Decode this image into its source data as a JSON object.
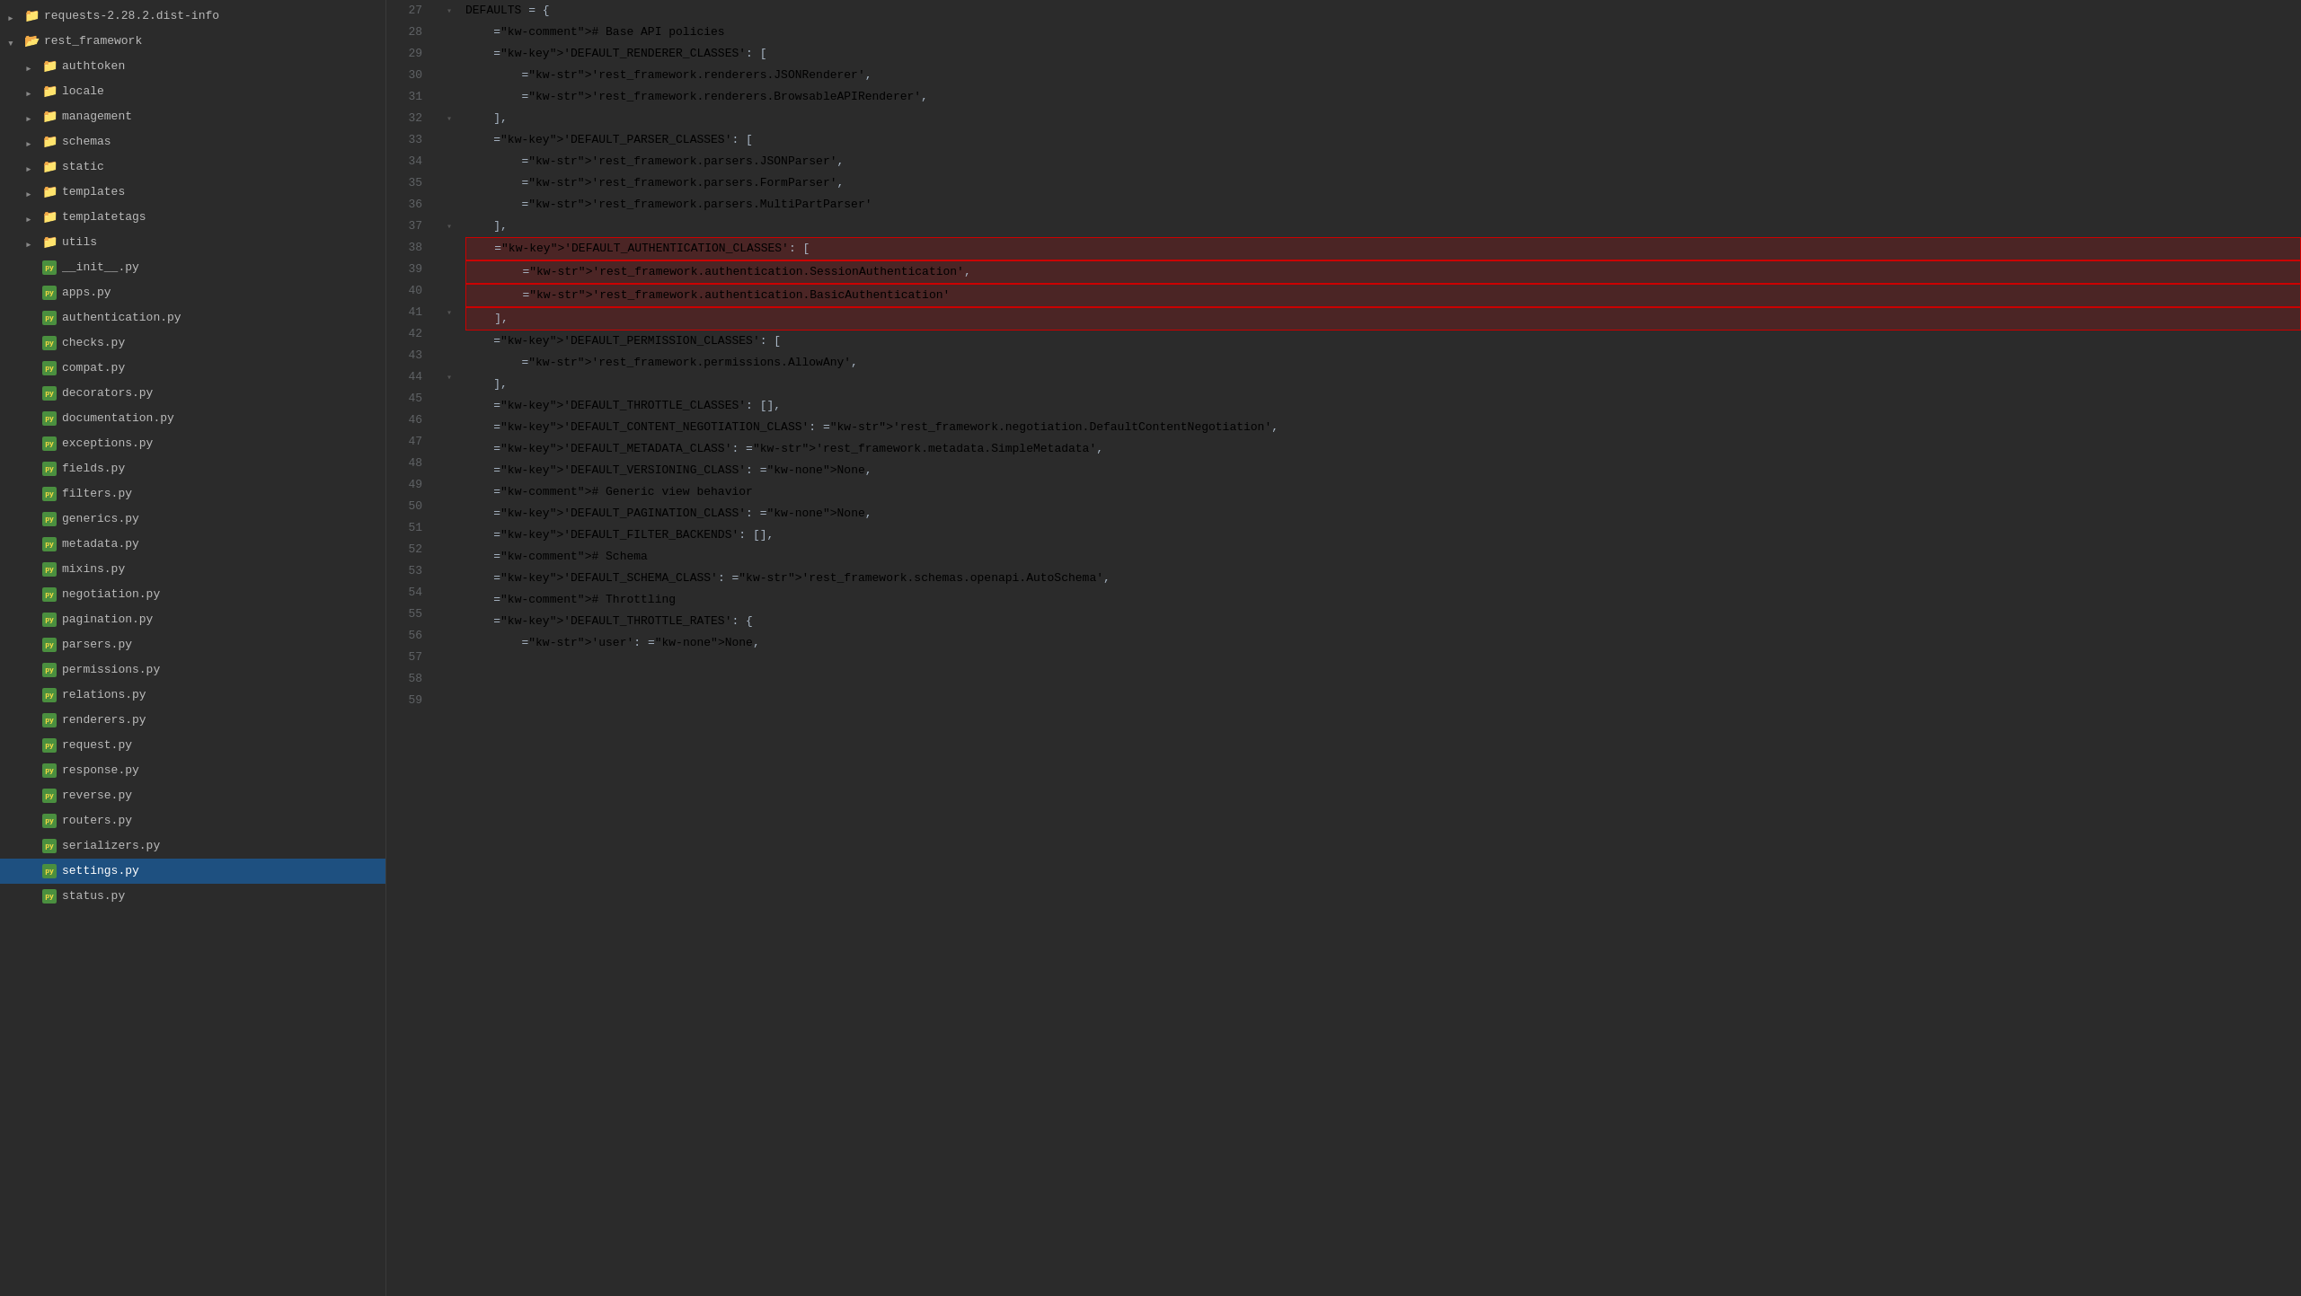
{
  "sidebar": {
    "items": [
      {
        "id": "requests-dist",
        "label": "requests-2.28.2.dist-info",
        "type": "folder",
        "state": "closed",
        "indent": 1
      },
      {
        "id": "rest_framework",
        "label": "rest_framework",
        "type": "folder",
        "state": "open",
        "indent": 1
      },
      {
        "id": "authtoken",
        "label": "authtoken",
        "type": "folder",
        "state": "closed",
        "indent": 2
      },
      {
        "id": "locale",
        "label": "locale",
        "type": "folder",
        "state": "closed",
        "indent": 2
      },
      {
        "id": "management",
        "label": "management",
        "type": "folder",
        "state": "closed",
        "indent": 2
      },
      {
        "id": "schemas",
        "label": "schemas",
        "type": "folder",
        "state": "closed",
        "indent": 2
      },
      {
        "id": "static",
        "label": "static",
        "type": "folder",
        "state": "closed",
        "indent": 2
      },
      {
        "id": "templates",
        "label": "templates",
        "type": "folder",
        "state": "closed",
        "indent": 2
      },
      {
        "id": "templatetags",
        "label": "templatetags",
        "type": "folder",
        "state": "closed",
        "indent": 2
      },
      {
        "id": "utils",
        "label": "utils",
        "type": "folder",
        "state": "closed",
        "indent": 2
      },
      {
        "id": "__init__.py",
        "label": "__init__.py",
        "type": "file",
        "indent": 2
      },
      {
        "id": "apps.py",
        "label": "apps.py",
        "type": "file",
        "indent": 2
      },
      {
        "id": "authentication.py",
        "label": "authentication.py",
        "type": "file",
        "indent": 2
      },
      {
        "id": "checks.py",
        "label": "checks.py",
        "type": "file",
        "indent": 2
      },
      {
        "id": "compat.py",
        "label": "compat.py",
        "type": "file",
        "indent": 2
      },
      {
        "id": "decorators.py",
        "label": "decorators.py",
        "type": "file",
        "indent": 2
      },
      {
        "id": "documentation.py",
        "label": "documentation.py",
        "type": "file",
        "indent": 2
      },
      {
        "id": "exceptions.py",
        "label": "exceptions.py",
        "type": "file",
        "indent": 2
      },
      {
        "id": "fields.py",
        "label": "fields.py",
        "type": "file",
        "indent": 2
      },
      {
        "id": "filters.py",
        "label": "filters.py",
        "type": "file",
        "indent": 2
      },
      {
        "id": "generics.py",
        "label": "generics.py",
        "type": "file",
        "indent": 2
      },
      {
        "id": "metadata.py",
        "label": "metadata.py",
        "type": "file",
        "indent": 2
      },
      {
        "id": "mixins.py",
        "label": "mixins.py",
        "type": "file",
        "indent": 2
      },
      {
        "id": "negotiation.py",
        "label": "negotiation.py",
        "type": "file",
        "indent": 2
      },
      {
        "id": "pagination.py",
        "label": "pagination.py",
        "type": "file",
        "indent": 2
      },
      {
        "id": "parsers.py",
        "label": "parsers.py",
        "type": "file",
        "indent": 2
      },
      {
        "id": "permissions.py",
        "label": "permissions.py",
        "type": "file",
        "indent": 2
      },
      {
        "id": "relations.py",
        "label": "relations.py",
        "type": "file",
        "indent": 2
      },
      {
        "id": "renderers.py",
        "label": "renderers.py",
        "type": "file",
        "indent": 2
      },
      {
        "id": "request.py",
        "label": "request.py",
        "type": "file",
        "indent": 2
      },
      {
        "id": "response.py",
        "label": "response.py",
        "type": "file",
        "indent": 2
      },
      {
        "id": "reverse.py",
        "label": "reverse.py",
        "type": "file",
        "indent": 2
      },
      {
        "id": "routers.py",
        "label": "routers.py",
        "type": "file",
        "indent": 2
      },
      {
        "id": "serializers.py",
        "label": "serializers.py",
        "type": "file",
        "indent": 2
      },
      {
        "id": "settings.py",
        "label": "settings.py",
        "type": "file",
        "indent": 2,
        "active": true
      },
      {
        "id": "status.py",
        "label": "status.py",
        "type": "file",
        "indent": 2
      }
    ]
  },
  "editor": {
    "lines": [
      {
        "num": 27,
        "content": "DEFAULTS = {",
        "fold": true,
        "highlighted": false
      },
      {
        "num": 28,
        "content": "    # Base API policies",
        "fold": false,
        "highlighted": false
      },
      {
        "num": 29,
        "content": "    'DEFAULT_RENDERER_CLASSES': [",
        "fold": false,
        "highlighted": false
      },
      {
        "num": 30,
        "content": "        'rest_framework.renderers.JSONRenderer',",
        "fold": false,
        "highlighted": false
      },
      {
        "num": 31,
        "content": "        'rest_framework.renderers.BrowsableAPIRenderer',",
        "fold": false,
        "highlighted": false
      },
      {
        "num": 32,
        "content": "    ],",
        "fold": true,
        "highlighted": false
      },
      {
        "num": 33,
        "content": "    'DEFAULT_PARSER_CLASSES': [",
        "fold": false,
        "highlighted": false
      },
      {
        "num": 34,
        "content": "        'rest_framework.parsers.JSONParser',",
        "fold": false,
        "highlighted": false
      },
      {
        "num": 35,
        "content": "        'rest_framework.parsers.FormParser',",
        "fold": false,
        "highlighted": false
      },
      {
        "num": 36,
        "content": "        'rest_framework.parsers.MultiPartParser'",
        "fold": false,
        "highlighted": false
      },
      {
        "num": 37,
        "content": "    ],",
        "fold": true,
        "highlighted": false
      },
      {
        "num": 38,
        "content": "    'DEFAULT_AUTHENTICATION_CLASSES': [",
        "fold": false,
        "highlighted": true
      },
      {
        "num": 39,
        "content": "        'rest_framework.authentication.SessionAuthentication',",
        "fold": false,
        "highlighted": true
      },
      {
        "num": 40,
        "content": "        'rest_framework.authentication.BasicAuthentication'",
        "fold": false,
        "highlighted": true
      },
      {
        "num": 41,
        "content": "    ],",
        "fold": true,
        "highlighted": true
      },
      {
        "num": 42,
        "content": "    'DEFAULT_PERMISSION_CLASSES': [",
        "fold": false,
        "highlighted": false
      },
      {
        "num": 43,
        "content": "        'rest_framework.permissions.AllowAny',",
        "fold": false,
        "highlighted": false
      },
      {
        "num": 44,
        "content": "    ],",
        "fold": true,
        "highlighted": false
      },
      {
        "num": 45,
        "content": "    'DEFAULT_THROTTLE_CLASSES': [],",
        "fold": false,
        "highlighted": false
      },
      {
        "num": 46,
        "content": "    'DEFAULT_CONTENT_NEGOTIATION_CLASS': 'rest_framework.negotiation.DefaultContentNegotiation',",
        "fold": false,
        "highlighted": false
      },
      {
        "num": 47,
        "content": "    'DEFAULT_METADATA_CLASS': 'rest_framework.metadata.SimpleMetadata',",
        "fold": false,
        "highlighted": false
      },
      {
        "num": 48,
        "content": "    'DEFAULT_VERSIONING_CLASS': None,",
        "fold": false,
        "highlighted": false
      },
      {
        "num": 49,
        "content": "",
        "fold": false,
        "highlighted": false
      },
      {
        "num": 50,
        "content": "    # Generic view behavior",
        "fold": false,
        "highlighted": false
      },
      {
        "num": 51,
        "content": "    'DEFAULT_PAGINATION_CLASS': None,",
        "fold": false,
        "highlighted": false
      },
      {
        "num": 52,
        "content": "    'DEFAULT_FILTER_BACKENDS': [],",
        "fold": false,
        "highlighted": false
      },
      {
        "num": 53,
        "content": "",
        "fold": false,
        "highlighted": false
      },
      {
        "num": 54,
        "content": "    # Schema",
        "fold": false,
        "highlighted": false
      },
      {
        "num": 55,
        "content": "    'DEFAULT_SCHEMA_CLASS': 'rest_framework.schemas.openapi.AutoSchema',",
        "fold": false,
        "highlighted": false
      },
      {
        "num": 56,
        "content": "",
        "fold": false,
        "highlighted": false
      },
      {
        "num": 57,
        "content": "    # Throttling",
        "fold": false,
        "highlighted": false
      },
      {
        "num": 58,
        "content": "    'DEFAULT_THROTTLE_RATES': {",
        "fold": false,
        "highlighted": false
      },
      {
        "num": 59,
        "content": "        'user': None,",
        "fold": false,
        "highlighted": false
      }
    ]
  }
}
